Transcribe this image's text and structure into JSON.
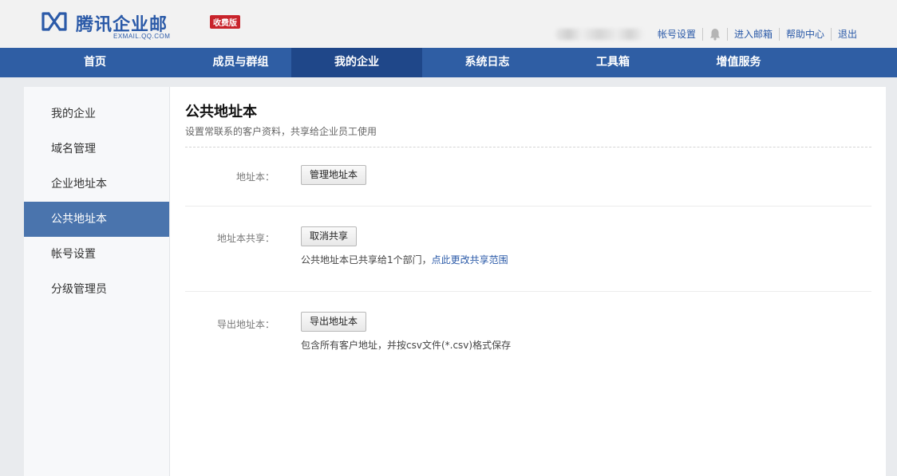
{
  "header": {
    "logo_text": "腾讯企业邮",
    "logo_sub": "EXMAIL.QQ.COM",
    "logo_badge": "收费版",
    "links": {
      "account_settings": "帐号设置",
      "enter_mailbox": "进入邮箱",
      "help_center": "帮助中心",
      "logout": "退出"
    }
  },
  "nav": {
    "items": [
      "首页",
      "成员与群组",
      "我的企业",
      "系统日志",
      "工具箱",
      "增值服务"
    ],
    "active": "我的企业"
  },
  "sidebar": {
    "items": [
      "我的企业",
      "域名管理",
      "企业地址本",
      "公共地址本",
      "帐号设置",
      "分级管理员"
    ],
    "active": "公共地址本"
  },
  "main": {
    "title": "公共地址本",
    "description": "设置常联系的客户资料，共享给企业员工使用",
    "rows": [
      {
        "label": "地址本：",
        "button": "管理地址本"
      },
      {
        "label": "地址本共享：",
        "button": "取消共享",
        "note": "公共地址本已共享给1个部门，",
        "note_link": "点此更改共享范围"
      },
      {
        "label": "导出地址本：",
        "button": "导出地址本",
        "note": "包含所有客户地址，并按csv文件(*.csv)格式保存"
      }
    ]
  },
  "colors": {
    "brand": "#2b5aa8",
    "nav_bg": "#2f5ea4",
    "nav_active": "#1f4789",
    "sidebar_active": "#4a74ad",
    "badge": "#c8232b"
  }
}
